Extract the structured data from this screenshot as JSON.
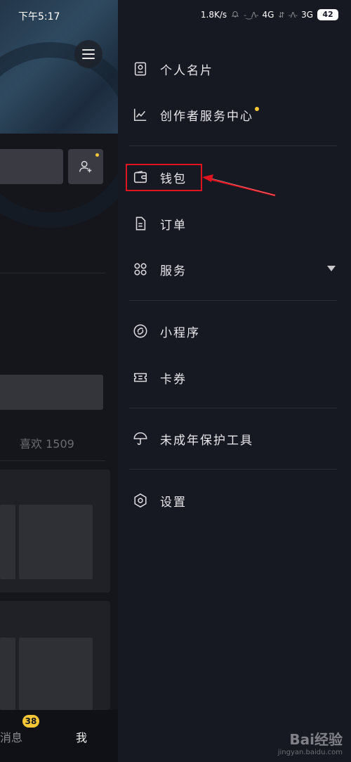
{
  "status_bar": {
    "time": "下午5:17",
    "speed": "1.8K/s",
    "network_1": "4G",
    "network_2": "3G",
    "battery": "42"
  },
  "profile_page": {
    "likes_label": "喜欢 1509",
    "nav": {
      "messages": "消息",
      "messages_badge": "38",
      "me": "我"
    }
  },
  "drawer": {
    "items": [
      {
        "label": "个人名片",
        "icon": "id-card-icon"
      },
      {
        "label": "创作者服务中心",
        "icon": "chart-line-icon",
        "has_dot": true
      },
      {
        "label": "钱包",
        "icon": "wallet-icon",
        "highlighted": true
      },
      {
        "label": "订单",
        "icon": "order-document-icon"
      },
      {
        "label": "服务",
        "icon": "services-grid-icon",
        "expandable": true
      },
      {
        "label": "小程序",
        "icon": "mini-program-link-icon"
      },
      {
        "label": "卡券",
        "icon": "coupon-ticket-icon"
      },
      {
        "label": "未成年保护工具",
        "icon": "umbrella-icon"
      },
      {
        "label": "设置",
        "icon": "settings-gear-icon"
      }
    ]
  },
  "annotation": {
    "highlight_color": "#e0141e"
  },
  "watermark": {
    "brand": "Bai经验",
    "url": "jingyan.baidu.com"
  },
  "colors": {
    "accent_dot": "#f7c637",
    "drawer_bg": "#171922"
  }
}
